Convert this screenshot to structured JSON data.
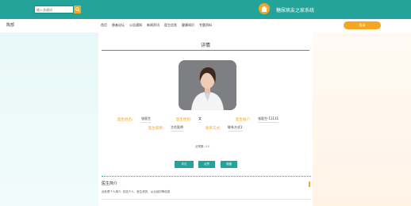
{
  "header": {
    "search_placeholder": "输入关键词",
    "site_title": "糖尿病友之家系统"
  },
  "nav": {
    "user": "陈部",
    "items": [
      "首页",
      "患者论坛",
      "公告通知",
      "新闻资讯",
      "医生信息",
      "健康知识",
      "专题资料"
    ],
    "login_label": "登录"
  },
  "detail": {
    "title": "详情",
    "fields": [
      {
        "label": "医生姓名:",
        "value": "张医生"
      },
      {
        "label": "医生性别:",
        "value": "女"
      },
      {
        "label": "医生账户:",
        "value": "张医生-11111"
      },
      {
        "label": "医生职称:",
        "value": "主任医师"
      },
      {
        "label": "联系方式:",
        "value": "联系方式1"
      }
    ],
    "points_label": "点赞数:",
    "points_value": "0.0",
    "buttons": [
      "评论",
      "点赞",
      "收藏"
    ]
  },
  "intro": {
    "title": "医生简介",
    "text": "此处是个人简介, 包括个人、医生资历、从业经历等信息"
  },
  "colors": {
    "primary": "#23a39a",
    "accent": "#f5a623"
  }
}
